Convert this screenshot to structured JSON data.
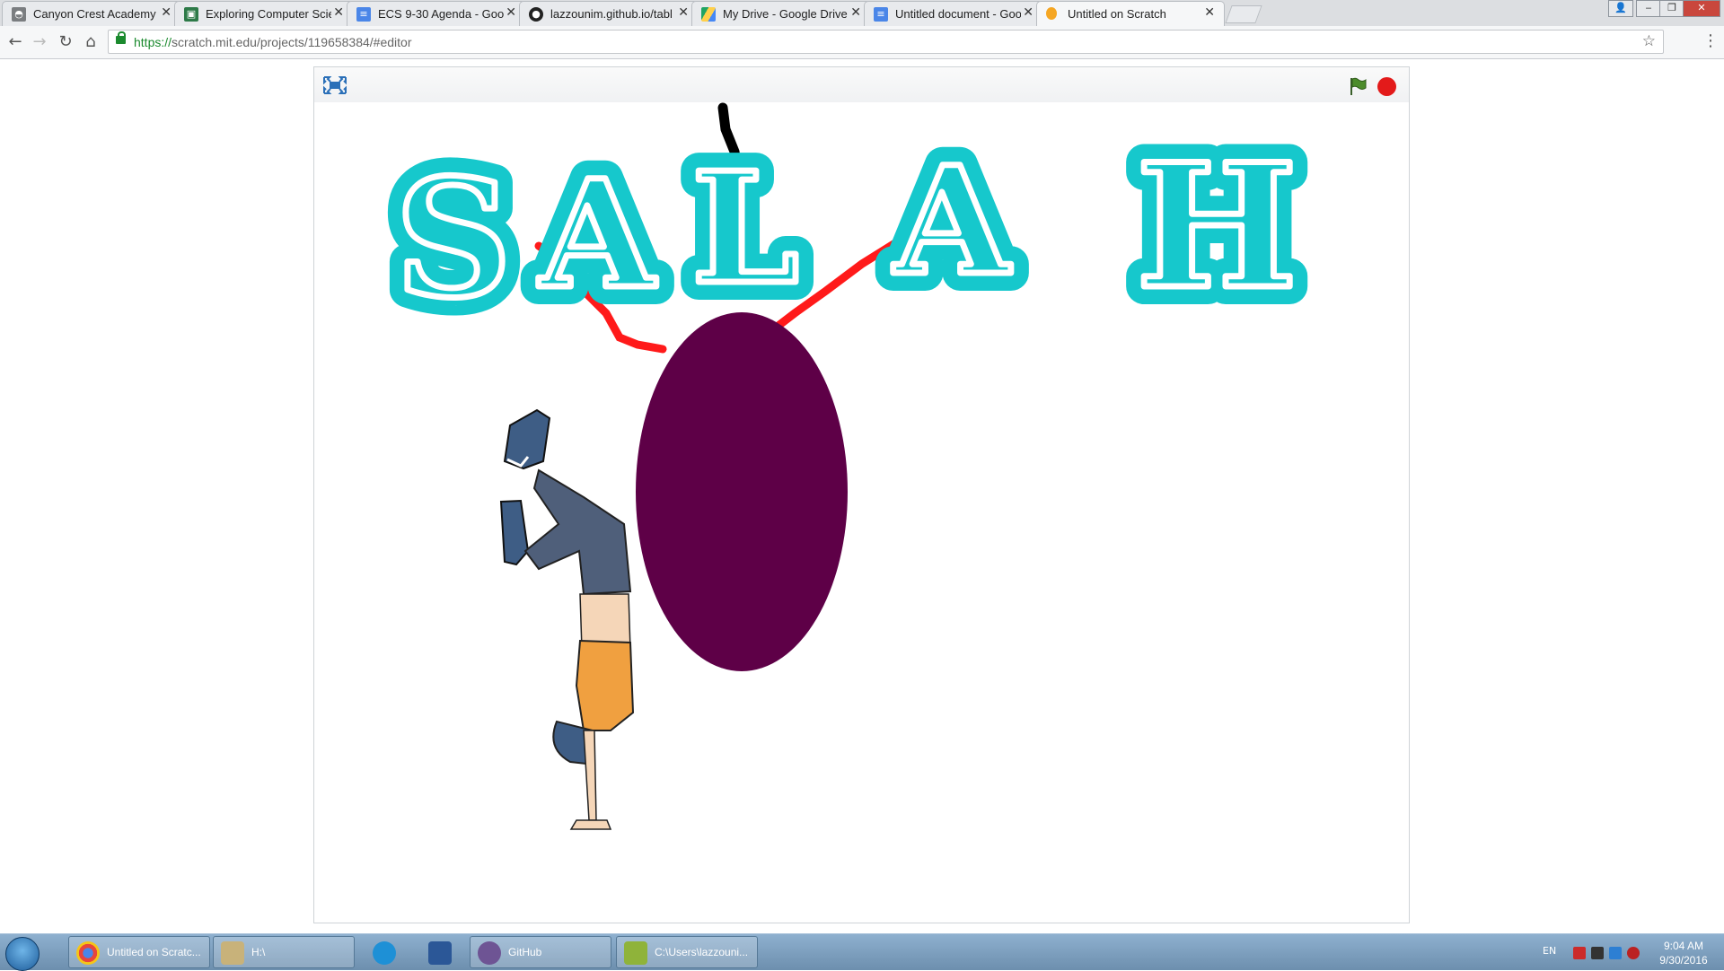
{
  "browser": {
    "tabs": [
      {
        "title": "Canyon Crest Academy -",
        "icon": "canyon-crest-favicon",
        "color": "#7a7d80"
      },
      {
        "title": "Exploring Computer Scie",
        "icon": "classroom-favicon",
        "color": "#2d7a48"
      },
      {
        "title": "ECS 9-30 Agenda - Goog",
        "icon": "google-docs-favicon",
        "color": "#4a86e8"
      },
      {
        "title": "lazzounim.github.io/tabl",
        "icon": "github-favicon",
        "color": "#222222"
      },
      {
        "title": "My Drive - Google Drive",
        "icon": "google-drive-favicon",
        "color": "#1fa463"
      },
      {
        "title": "Untitled document - Goo",
        "icon": "google-docs-favicon",
        "color": "#4a86e8"
      },
      {
        "title": "Untitled on Scratch",
        "icon": "scratch-favicon",
        "color": "#f5a623",
        "active": true
      }
    ],
    "close_glyph": "✕",
    "url_scheme": "https://",
    "url_rest": "scratch.mit.edu/projects/119658384/#editor"
  },
  "stage": {
    "letters": [
      "S",
      "A",
      "L",
      "A",
      "H"
    ],
    "letter_fill": "#ffffff",
    "letter_outline": "#16c8cc",
    "ellipse_color": "#5e0047",
    "line_color": "#ff1a1a",
    "string_color": "#000000"
  },
  "taskbar": {
    "items": [
      {
        "label": "Untitled on Scratc...",
        "icon": "chrome-icon",
        "color": "#e8453c"
      },
      {
        "label": "H:\\",
        "icon": "folder-icon",
        "color": "#c8b27a"
      },
      {
        "label": "",
        "icon": "internet-explorer-icon",
        "color": "#1e90d6"
      },
      {
        "label": "",
        "icon": "word-icon",
        "color": "#2b5797"
      },
      {
        "label": "GitHub",
        "icon": "github-desktop-icon",
        "color": "#6e5494"
      },
      {
        "label": "C:\\Users\\lazzouni...",
        "icon": "application-icon",
        "color": "#8fb33a"
      }
    ],
    "lang": "EN",
    "time": "9:04 AM",
    "date": "9/30/2016"
  }
}
